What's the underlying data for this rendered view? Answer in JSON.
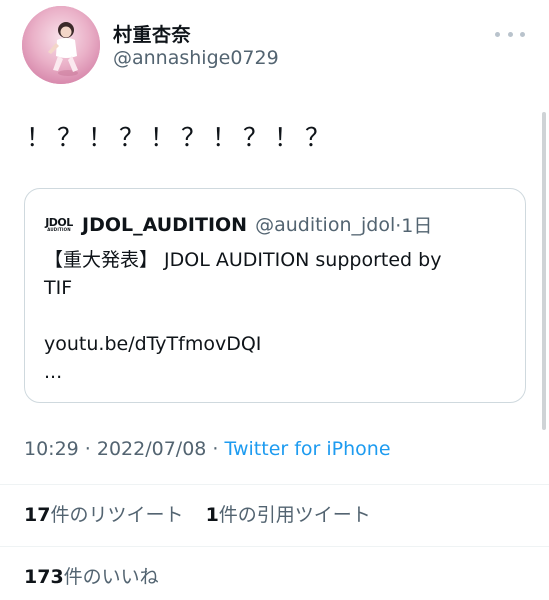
{
  "author": {
    "display_name": "村重杏奈",
    "handle": "@annashige0729",
    "avatar_icon": "profile-photo"
  },
  "tweet": {
    "text": "！？！？！？！？！？"
  },
  "quote": {
    "logo_line1": "JDOL",
    "logo_line2": "AUDITION",
    "name": "JDOL_AUDITION",
    "handle": "@audition_jdol",
    "time": "·1日",
    "line1": "【重大発表】 JDOL AUDITION supported by",
    "line2": "TIF",
    "link": "youtu.be/dTyTfmovDQI",
    "ellipsis": "..."
  },
  "meta": {
    "timestamp": "10:29 · 2022/07/08 · ",
    "source": "Twitter for iPhone"
  },
  "stats": {
    "retweets_count": "17",
    "retweets_label": "件のリツイート",
    "quotes_count": "1",
    "quotes_label": "件の引用ツイート",
    "likes_count": "173",
    "likes_label": "件のいいね"
  },
  "colors": {
    "link": "#1d9bf0",
    "secondary_text": "#536471",
    "border": "#cfd9de"
  }
}
